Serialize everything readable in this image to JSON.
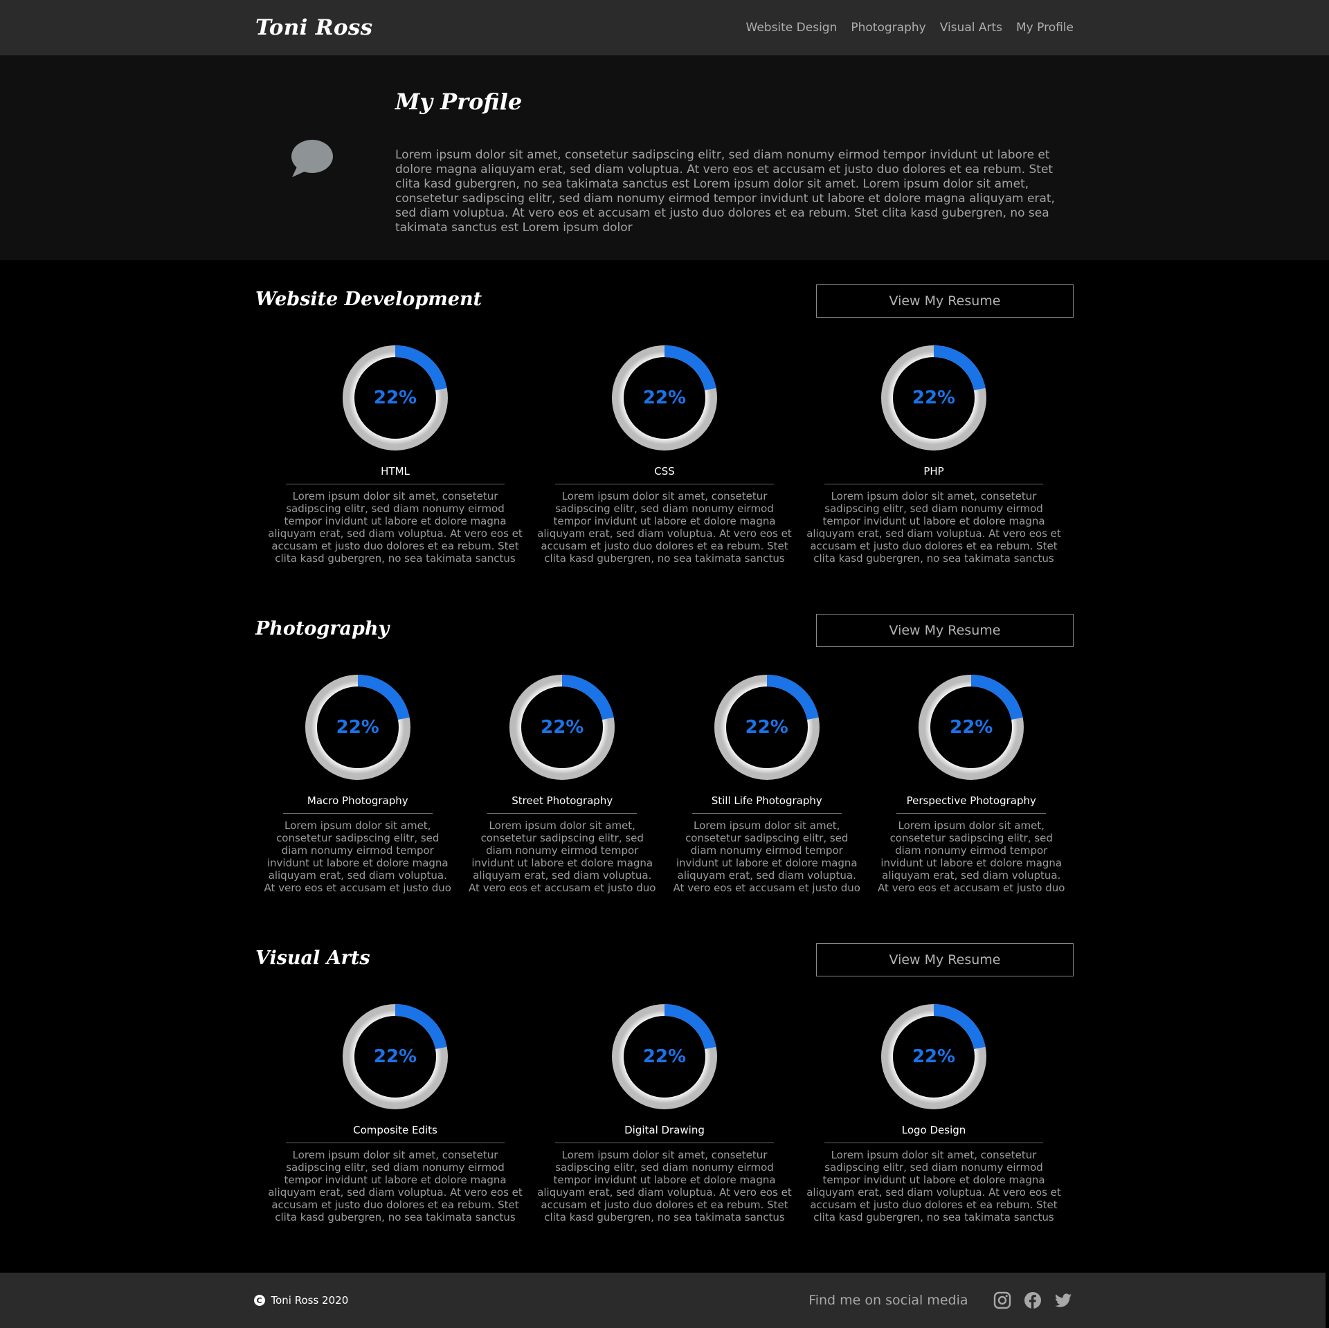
{
  "header": {
    "brand": "Toni Ross",
    "nav": [
      "Website Design",
      "Photography",
      "Visual Arts",
      "My Profile"
    ]
  },
  "profile": {
    "title": "My Profile",
    "text": "Lorem ipsum dolor sit amet, consetetur sadipscing elitr, sed diam nonumy eirmod tempor invidunt ut labore et dolore magna aliquyam erat, sed diam voluptua. At vero eos et accusam et justo duo dolores et ea rebum. Stet clita kasd gubergren, no sea takimata sanctus est Lorem ipsum dolor sit amet. Lorem ipsum dolor sit amet, consetetur sadipscing elitr, sed diam nonumy eirmod tempor invidunt ut labore et dolore magna aliquyam erat, sed diam voluptua. At vero eos et accusam et justo duo dolores et ea rebum. Stet clita kasd gubergren, no sea takimata sanctus est Lorem ipsum dolor",
    "icon": "chat-bubble-icon"
  },
  "sections": [
    {
      "title": "Website Development",
      "button": "View My Resume",
      "skills": [
        {
          "name": "HTML",
          "percent": "22%",
          "value": 22,
          "desc": "Lorem ipsum dolor sit amet, consetetur sadipscing elitr, sed diam nonumy eirmod tempor invidunt ut labore et dolore magna aliquyam erat, sed diam voluptua. At vero eos et accusam et justo duo dolores et ea rebum. Stet clita kasd gubergren, no sea takimata sanctus est Lorem ipsum dolor sit"
        },
        {
          "name": "CSS",
          "percent": "22%",
          "value": 22,
          "desc": "Lorem ipsum dolor sit amet, consetetur sadipscing elitr, sed diam nonumy eirmod tempor invidunt ut labore et dolore magna aliquyam erat, sed diam voluptua. At vero eos et accusam et justo duo dolores et ea rebum. Stet clita kasd gubergren, no sea takimata sanctus est Lorem ipsum dolor sit"
        },
        {
          "name": "PHP",
          "percent": "22%",
          "value": 22,
          "desc": "Lorem ipsum dolor sit amet, consetetur sadipscing elitr, sed diam nonumy eirmod tempor invidunt ut labore et dolore magna aliquyam erat, sed diam voluptua. At vero eos et accusam et justo duo dolores et ea rebum. Stet clita kasd gubergren, no sea takimata sanctus est Lorem ipsum dolor sit"
        }
      ]
    },
    {
      "title": "Photography",
      "button": "View My Resume",
      "skills": [
        {
          "name": "Macro Photography",
          "percent": "22%",
          "value": 22,
          "desc": "Lorem ipsum dolor sit amet, consetetur sadipscing elitr, sed diam nonumy eirmod tempor invidunt ut labore et dolore magna aliquyam erat, sed diam voluptua. At vero eos et accusam et justo duo dolores et ea"
        },
        {
          "name": "Street Photography",
          "percent": "22%",
          "value": 22,
          "desc": "Lorem ipsum dolor sit amet, consetetur sadipscing elitr, sed diam nonumy eirmod tempor invidunt ut labore et dolore magna aliquyam erat, sed diam voluptua. At vero eos et accusam et justo duo dolores et ea"
        },
        {
          "name": "Still Life Photography",
          "percent": "22%",
          "value": 22,
          "desc": "Lorem ipsum dolor sit amet, consetetur sadipscing elitr, sed diam nonumy eirmod tempor invidunt ut labore et dolore magna aliquyam erat, sed diam voluptua. At vero eos et accusam et justo duo dolores et ea"
        },
        {
          "name": "Perspective Photography",
          "percent": "22%",
          "value": 22,
          "desc": "Lorem ipsum dolor sit amet, consetetur sadipscing elitr, sed diam nonumy eirmod tempor invidunt ut labore et dolore magna aliquyam erat, sed diam voluptua. At vero eos et accusam et justo duo dolores et ea"
        }
      ]
    },
    {
      "title": "Visual Arts",
      "button": "View My Resume",
      "skills": [
        {
          "name": "Composite Edits",
          "percent": "22%",
          "value": 22,
          "desc": "Lorem ipsum dolor sit amet, consetetur sadipscing elitr, sed diam nonumy eirmod tempor invidunt ut labore et dolore magna aliquyam erat, sed diam voluptua. At vero eos et accusam et justo duo dolores et ea rebum. Stet clita kasd gubergren, no sea takimata sanctus est Lorem ipsum dolor sit"
        },
        {
          "name": "Digital Drawing",
          "percent": "22%",
          "value": 22,
          "desc": "Lorem ipsum dolor sit amet, consetetur sadipscing elitr, sed diam nonumy eirmod tempor invidunt ut labore et dolore magna aliquyam erat, sed diam voluptua. At vero eos et accusam et justo duo dolores et ea rebum. Stet clita kasd gubergren, no sea takimata sanctus est Lorem ipsum dolor sit"
        },
        {
          "name": "Logo Design",
          "percent": "22%",
          "value": 22,
          "desc": "Lorem ipsum dolor sit amet, consetetur sadipscing elitr, sed diam nonumy eirmod tempor invidunt ut labore et dolore magna aliquyam erat, sed diam voluptua. At vero eos et accusam et justo duo dolores et ea rebum. Stet clita kasd gubergren, no sea takimata sanctus est Lorem ipsum dolor sit"
        }
      ]
    }
  ],
  "footer": {
    "copyright": "Toni Ross 2020",
    "copyright_icon": "copyright-icon",
    "social_text": "Find me on social media",
    "social_icons": [
      "instagram-icon",
      "facebook-icon",
      "twitter-icon"
    ]
  },
  "colors": {
    "accent": "#1b73e8",
    "ring_track": "#d9d9d9",
    "header_bg": "#2b2b2b",
    "profile_bg": "#101010",
    "page_bg": "#000000"
  }
}
